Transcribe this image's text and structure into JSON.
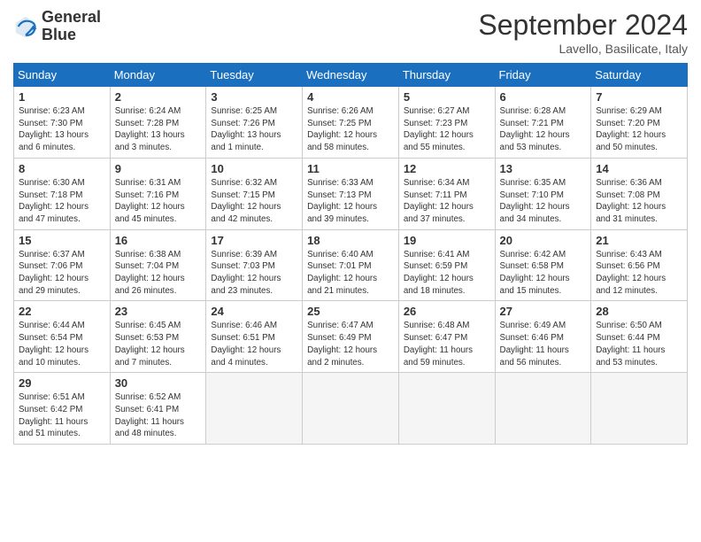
{
  "logo": {
    "line1": "General",
    "line2": "Blue"
  },
  "title": "September 2024",
  "location": "Lavello, Basilicate, Italy",
  "days_header": [
    "Sunday",
    "Monday",
    "Tuesday",
    "Wednesday",
    "Thursday",
    "Friday",
    "Saturday"
  ],
  "weeks": [
    [
      {
        "day": "1",
        "info": "Sunrise: 6:23 AM\nSunset: 7:30 PM\nDaylight: 13 hours\nand 6 minutes."
      },
      {
        "day": "2",
        "info": "Sunrise: 6:24 AM\nSunset: 7:28 PM\nDaylight: 13 hours\nand 3 minutes."
      },
      {
        "day": "3",
        "info": "Sunrise: 6:25 AM\nSunset: 7:26 PM\nDaylight: 13 hours\nand 1 minute."
      },
      {
        "day": "4",
        "info": "Sunrise: 6:26 AM\nSunset: 7:25 PM\nDaylight: 12 hours\nand 58 minutes."
      },
      {
        "day": "5",
        "info": "Sunrise: 6:27 AM\nSunset: 7:23 PM\nDaylight: 12 hours\nand 55 minutes."
      },
      {
        "day": "6",
        "info": "Sunrise: 6:28 AM\nSunset: 7:21 PM\nDaylight: 12 hours\nand 53 minutes."
      },
      {
        "day": "7",
        "info": "Sunrise: 6:29 AM\nSunset: 7:20 PM\nDaylight: 12 hours\nand 50 minutes."
      }
    ],
    [
      {
        "day": "8",
        "info": "Sunrise: 6:30 AM\nSunset: 7:18 PM\nDaylight: 12 hours\nand 47 minutes."
      },
      {
        "day": "9",
        "info": "Sunrise: 6:31 AM\nSunset: 7:16 PM\nDaylight: 12 hours\nand 45 minutes."
      },
      {
        "day": "10",
        "info": "Sunrise: 6:32 AM\nSunset: 7:15 PM\nDaylight: 12 hours\nand 42 minutes."
      },
      {
        "day": "11",
        "info": "Sunrise: 6:33 AM\nSunset: 7:13 PM\nDaylight: 12 hours\nand 39 minutes."
      },
      {
        "day": "12",
        "info": "Sunrise: 6:34 AM\nSunset: 7:11 PM\nDaylight: 12 hours\nand 37 minutes."
      },
      {
        "day": "13",
        "info": "Sunrise: 6:35 AM\nSunset: 7:10 PM\nDaylight: 12 hours\nand 34 minutes."
      },
      {
        "day": "14",
        "info": "Sunrise: 6:36 AM\nSunset: 7:08 PM\nDaylight: 12 hours\nand 31 minutes."
      }
    ],
    [
      {
        "day": "15",
        "info": "Sunrise: 6:37 AM\nSunset: 7:06 PM\nDaylight: 12 hours\nand 29 minutes."
      },
      {
        "day": "16",
        "info": "Sunrise: 6:38 AM\nSunset: 7:04 PM\nDaylight: 12 hours\nand 26 minutes."
      },
      {
        "day": "17",
        "info": "Sunrise: 6:39 AM\nSunset: 7:03 PM\nDaylight: 12 hours\nand 23 minutes."
      },
      {
        "day": "18",
        "info": "Sunrise: 6:40 AM\nSunset: 7:01 PM\nDaylight: 12 hours\nand 21 minutes."
      },
      {
        "day": "19",
        "info": "Sunrise: 6:41 AM\nSunset: 6:59 PM\nDaylight: 12 hours\nand 18 minutes."
      },
      {
        "day": "20",
        "info": "Sunrise: 6:42 AM\nSunset: 6:58 PM\nDaylight: 12 hours\nand 15 minutes."
      },
      {
        "day": "21",
        "info": "Sunrise: 6:43 AM\nSunset: 6:56 PM\nDaylight: 12 hours\nand 12 minutes."
      }
    ],
    [
      {
        "day": "22",
        "info": "Sunrise: 6:44 AM\nSunset: 6:54 PM\nDaylight: 12 hours\nand 10 minutes."
      },
      {
        "day": "23",
        "info": "Sunrise: 6:45 AM\nSunset: 6:53 PM\nDaylight: 12 hours\nand 7 minutes."
      },
      {
        "day": "24",
        "info": "Sunrise: 6:46 AM\nSunset: 6:51 PM\nDaylight: 12 hours\nand 4 minutes."
      },
      {
        "day": "25",
        "info": "Sunrise: 6:47 AM\nSunset: 6:49 PM\nDaylight: 12 hours\nand 2 minutes."
      },
      {
        "day": "26",
        "info": "Sunrise: 6:48 AM\nSunset: 6:47 PM\nDaylight: 11 hours\nand 59 minutes."
      },
      {
        "day": "27",
        "info": "Sunrise: 6:49 AM\nSunset: 6:46 PM\nDaylight: 11 hours\nand 56 minutes."
      },
      {
        "day": "28",
        "info": "Sunrise: 6:50 AM\nSunset: 6:44 PM\nDaylight: 11 hours\nand 53 minutes."
      }
    ],
    [
      {
        "day": "29",
        "info": "Sunrise: 6:51 AM\nSunset: 6:42 PM\nDaylight: 11 hours\nand 51 minutes."
      },
      {
        "day": "30",
        "info": "Sunrise: 6:52 AM\nSunset: 6:41 PM\nDaylight: 11 hours\nand 48 minutes."
      },
      {
        "day": "",
        "info": ""
      },
      {
        "day": "",
        "info": ""
      },
      {
        "day": "",
        "info": ""
      },
      {
        "day": "",
        "info": ""
      },
      {
        "day": "",
        "info": ""
      }
    ]
  ]
}
